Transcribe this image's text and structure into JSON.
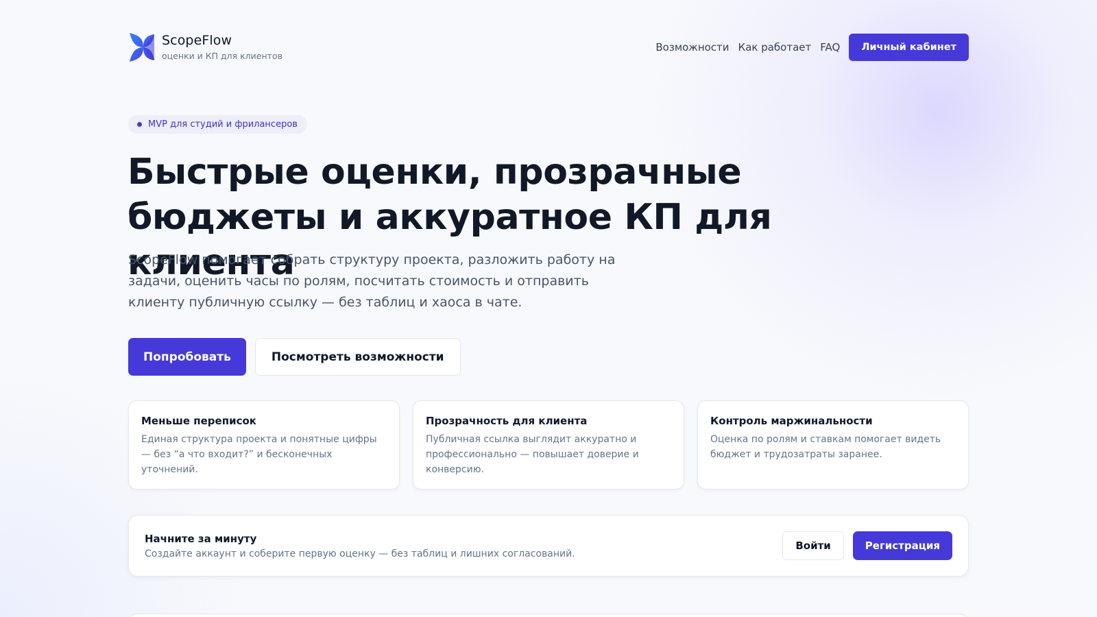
{
  "header": {
    "brand_name": "ScopeFlow",
    "brand_tagline": "оценки и КП для клиентов",
    "logo_icon": "scopeflow-logo-icon",
    "nav": [
      {
        "label": "Возможности"
      },
      {
        "label": "Как работает"
      },
      {
        "label": "FAQ"
      }
    ],
    "cabinet_label": "Личный кабинет"
  },
  "hero": {
    "badge": "MVP для студий и фрилансеров",
    "title": "Быстрые оценки, прозрачные бюджеты и аккуратное КП для клиента",
    "description": "ScopeFlow помогает собрать структуру проекта, разложить работу на задачи, оценить часы по ролям, посчитать стоимость и отправить клиенту публичную ссылку — без таблиц и хаоса в чате.",
    "primary_label": "Попробовать",
    "secondary_label": "Посмотреть возможности"
  },
  "features": [
    {
      "title": "Меньше переписок",
      "text": "Единая структура проекта и понятные цифры — без “а что входит?” и бесконечных уточнений."
    },
    {
      "title": "Прозрачность для клиента",
      "text": "Публичная ссылка выглядит аккуратно и профессионально — повышает доверие и конверсию."
    },
    {
      "title": "Контроль маржинальности",
      "text": "Оценка по ролям и ставкам помогает видеть бюджет и трудозатраты заранее."
    }
  ],
  "cta": {
    "title": "Начните за минуту",
    "text": "Создайте аккаунт и соберите первую оценку — без таблиц и лишних согласований.",
    "login_label": "Войти",
    "register_label": "Регистрация"
  },
  "colors": {
    "accent": "#4539d9",
    "background": "#f8f9fc",
    "text_primary": "#0f172a",
    "text_muted": "#64748b"
  }
}
